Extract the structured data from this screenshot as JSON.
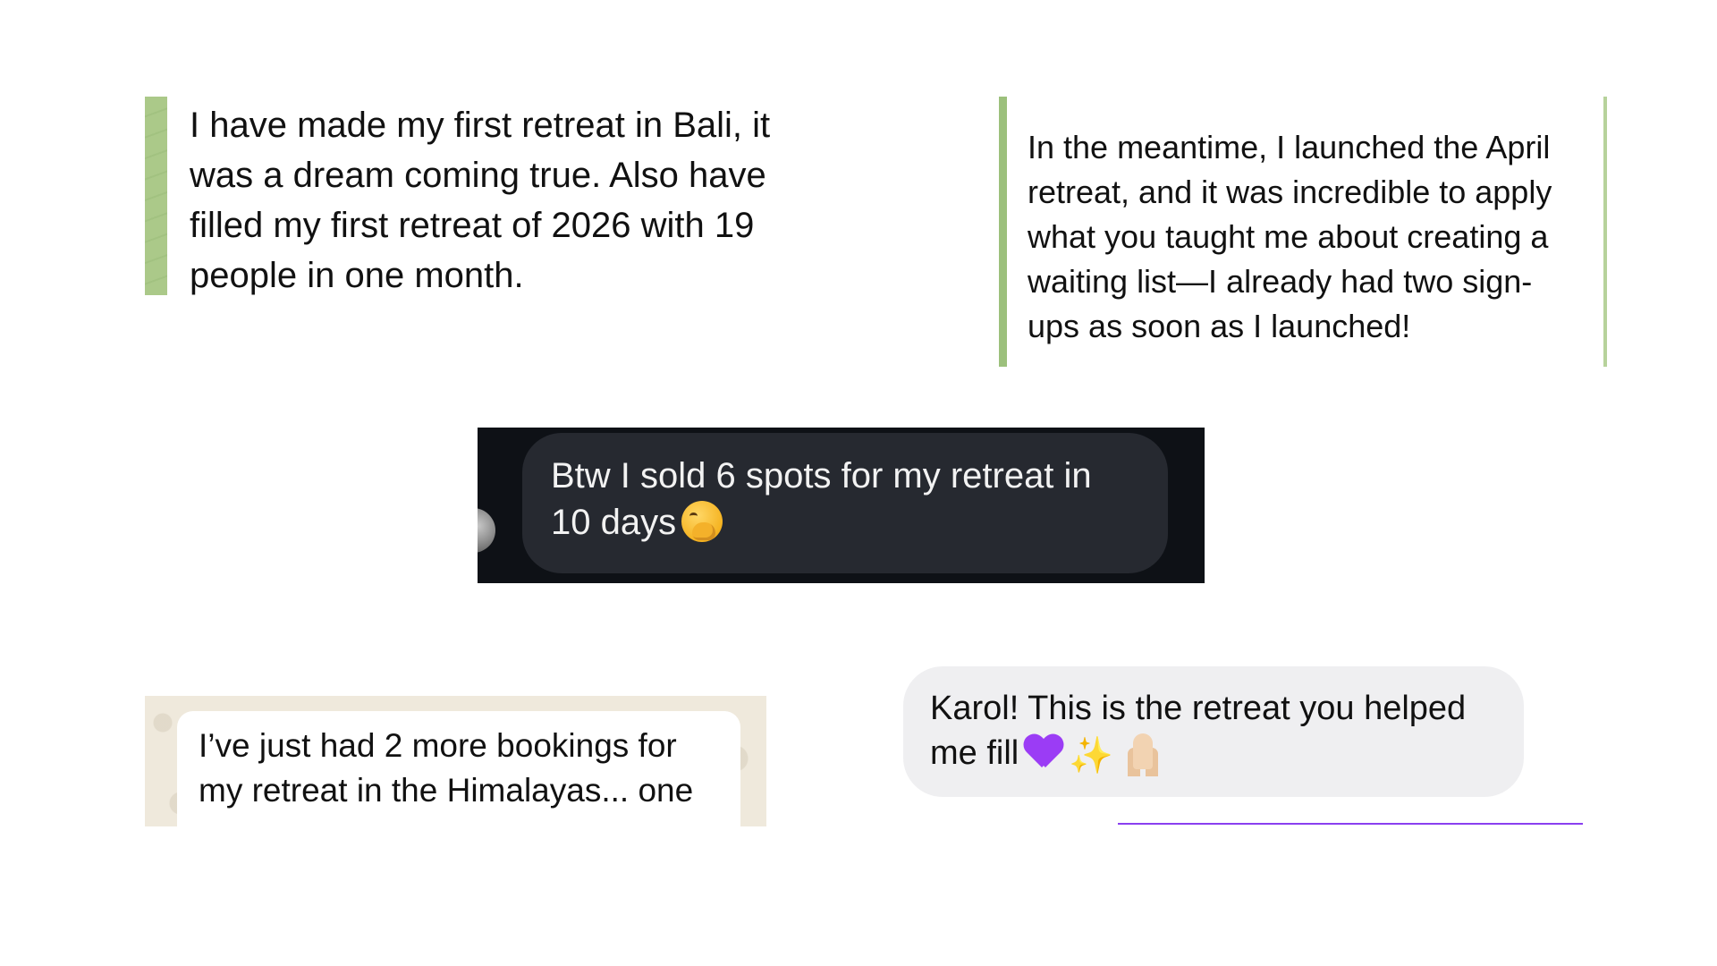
{
  "testimonials": {
    "quote_one": {
      "text": "I have made my first retreat in Bali, it\nwas a dream coming true. Also have\nfilled my first retreat of 2026 with 19\npeople in one month.",
      "accent_color": "#abc989"
    },
    "quote_two": {
      "text": "In the meantime, I launched the April\nretreat, and it was incredible to apply\nwhat you taught me about creating a\nwaiting list—I already had two sign-\nups as soon as I launched!",
      "accent_color": "#9cc07c"
    },
    "dark_message": {
      "text": "Btw I sold 6 spots for my retreat in\n10 days",
      "emoji": "hand-over-mouth-face-icon",
      "background_color": "#0e1116",
      "bubble_color": "#262930"
    },
    "whatsapp_message": {
      "text": "I’ve just had 2 more bookings for\nmy retreat in the Himalayas... one",
      "background_color": "#efe9dc"
    },
    "grey_message": {
      "text": "Karol! This is the retreat you helped\nme fill",
      "emojis": [
        "purple-heart-icon",
        "sparkles-icon",
        "folded-hands-icon"
      ],
      "bubble_color": "#efeff1",
      "accent_color": "#8a3ff0"
    }
  }
}
